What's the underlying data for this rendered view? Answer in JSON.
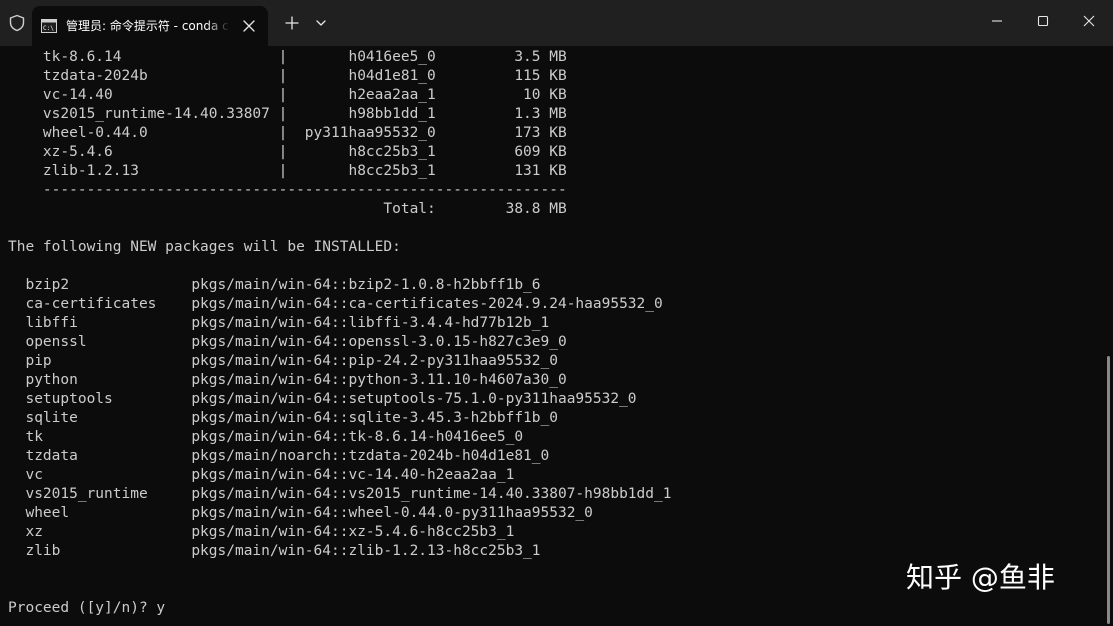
{
  "window": {
    "tab_title": "管理员: 命令提示符 - conda  create -n",
    "colors": {
      "titlebar": "#202020",
      "background": "#0c0c0c",
      "text": "#cccccc"
    }
  },
  "terminal": {
    "lines": [
      "    tk-8.6.14                  |       h0416ee5_0         3.5 MB",
      "    tzdata-2024b               |       h04d1e81_0         115 KB",
      "    vc-14.40                   |       h2eaa2aa_1          10 KB",
      "    vs2015_runtime-14.40.33807 |       h98bb1dd_1         1.3 MB",
      "    wheel-0.44.0               |  py311haa95532_0         173 KB",
      "    xz-5.4.6                   |       h8cc25b3_1         609 KB",
      "    zlib-1.2.13                |       h8cc25b3_1         131 KB",
      "    ------------------------------------------------------------",
      "                                           Total:        38.8 MB",
      "",
      "The following NEW packages will be INSTALLED:",
      "",
      "  bzip2              pkgs/main/win-64::bzip2-1.0.8-h2bbff1b_6",
      "  ca-certificates    pkgs/main/win-64::ca-certificates-2024.9.24-haa95532_0",
      "  libffi             pkgs/main/win-64::libffi-3.4.4-hd77b12b_1",
      "  openssl            pkgs/main/win-64::openssl-3.0.15-h827c3e9_0",
      "  pip                pkgs/main/win-64::pip-24.2-py311haa95532_0",
      "  python             pkgs/main/win-64::python-3.11.10-h4607a30_0",
      "  setuptools         pkgs/main/win-64::setuptools-75.1.0-py311haa95532_0",
      "  sqlite             pkgs/main/win-64::sqlite-3.45.3-h2bbff1b_0",
      "  tk                 pkgs/main/win-64::tk-8.6.14-h0416ee5_0",
      "  tzdata             pkgs/main/noarch::tzdata-2024b-h04d1e81_0",
      "  vc                 pkgs/main/win-64::vc-14.40-h2eaa2aa_1",
      "  vs2015_runtime     pkgs/main/win-64::vs2015_runtime-14.40.33807-h98bb1dd_1",
      "  wheel              pkgs/main/win-64::wheel-0.44.0-py311haa95532_0",
      "  xz                 pkgs/main/win-64::xz-5.4.6-h8cc25b3_1",
      "  zlib               pkgs/main/win-64::zlib-1.2.13-h8cc25b3_1",
      "",
      "",
      "Proceed ([y]/n)? y"
    ]
  },
  "watermark": {
    "text": "知乎 @鱼非"
  },
  "icons": {
    "shield": "shield-icon",
    "tab": "command-prompt-icon",
    "close_tab": "close-icon",
    "new_tab": "plus-icon",
    "dropdown": "chevron-down-icon",
    "minimize": "minimize-icon",
    "maximize": "maximize-icon",
    "close": "close-icon"
  }
}
